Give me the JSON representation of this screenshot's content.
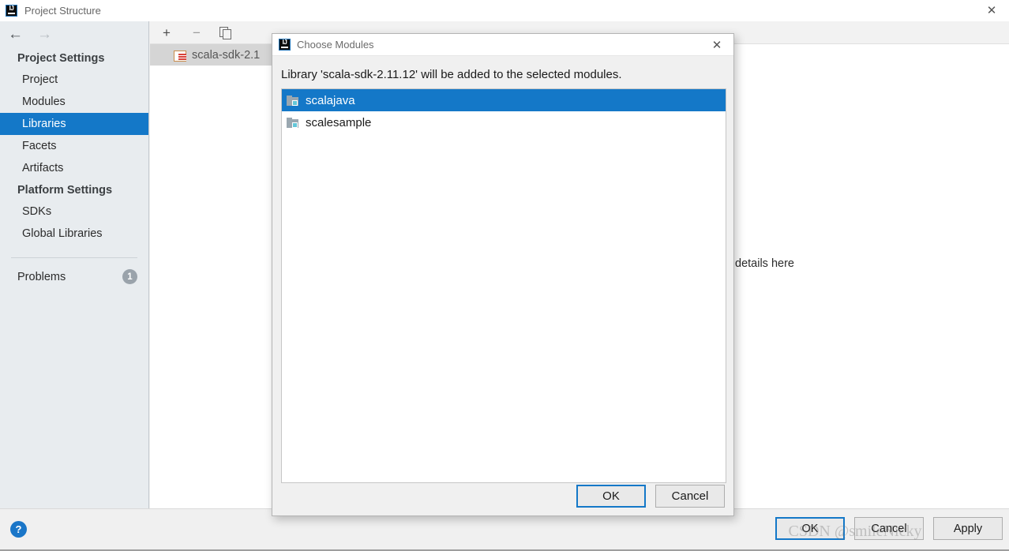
{
  "window": {
    "title": "Project Structure",
    "app_icon": "intellij-idea-icon",
    "close_label": "✕"
  },
  "sidebar": {
    "back_arrow": "←",
    "forward_arrow": "→",
    "groups": [
      {
        "heading": "Project Settings",
        "items": [
          {
            "label": "Project",
            "selected": false
          },
          {
            "label": "Modules",
            "selected": false
          },
          {
            "label": "Libraries",
            "selected": true
          },
          {
            "label": "Facets",
            "selected": false
          },
          {
            "label": "Artifacts",
            "selected": false
          }
        ]
      },
      {
        "heading": "Platform Settings",
        "items": [
          {
            "label": "SDKs",
            "selected": false
          },
          {
            "label": "Global Libraries",
            "selected": false
          }
        ]
      }
    ],
    "problems": {
      "label": "Problems",
      "count": "1"
    }
  },
  "content": {
    "toolbar": {
      "add_label": "+",
      "remove_label": "−",
      "copy_label": "copy-icon"
    },
    "library_rows": [
      {
        "name": "scala-sdk-2.1",
        "icon": "scala-sdk-icon"
      }
    ],
    "detail_text": "details here"
  },
  "dialog": {
    "title": "Choose Modules",
    "app_icon": "intellij-idea-icon",
    "close_label": "✕",
    "message": "Library 'scala-sdk-2.11.12' will be added to the selected modules.",
    "modules": [
      {
        "name": "scalajava",
        "selected": true,
        "icon": "module-folder-icon"
      },
      {
        "name": "scalesample",
        "selected": false,
        "icon": "module-folder-icon"
      }
    ],
    "buttons": {
      "ok": "OK",
      "cancel": "Cancel"
    }
  },
  "bottom_bar": {
    "help_label": "?",
    "buttons": {
      "ok": "OK",
      "cancel": "Cancel",
      "apply": "Apply"
    }
  },
  "watermark": "CSDN @smileNicky",
  "colors": {
    "accent_blue": "#1478c8",
    "sidebar_bg": "#e8ecef",
    "dialog_bg": "#f0f0f0",
    "selected_row": "#1478c8"
  }
}
